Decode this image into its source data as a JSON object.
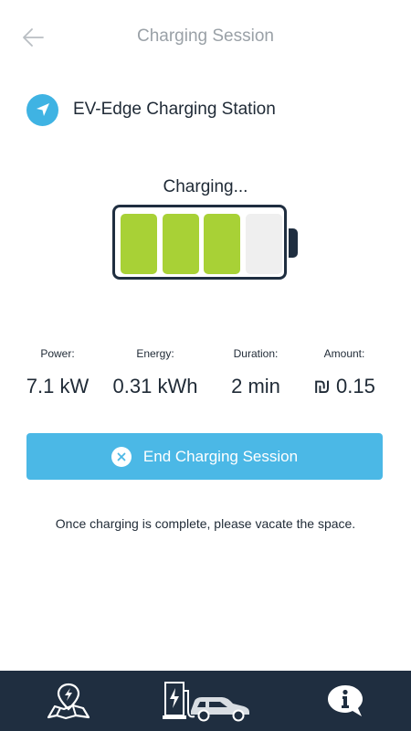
{
  "header": {
    "title": "Charging Session",
    "back_icon": "arrow-left-icon"
  },
  "station": {
    "icon": "navigation-arrow-icon",
    "name": "EV-Edge Charging Station"
  },
  "status": {
    "label": "Charging...",
    "battery_cells_total": 4,
    "battery_cells_filled": 3
  },
  "stats": [
    {
      "label": "Power:",
      "value": "7.1 kW"
    },
    {
      "label": "Energy:",
      "value": "0.31 kWh"
    },
    {
      "label": "Duration:",
      "value": "2 min"
    },
    {
      "label": "Amount:",
      "value": "₪ 0.15"
    }
  ],
  "end_button": {
    "label": "End Charging Session",
    "icon": "close-icon"
  },
  "notice": "Once charging is complete, please vacate the space.",
  "bottom_nav": [
    {
      "icon": "map-charging-pin-icon"
    },
    {
      "icon": "charger-car-icon"
    },
    {
      "icon": "info-bubble-icon"
    }
  ],
  "colors": {
    "accent": "#4bb8e6",
    "battery_fill": "#a8d136",
    "nav_background": "#1f2e40"
  }
}
